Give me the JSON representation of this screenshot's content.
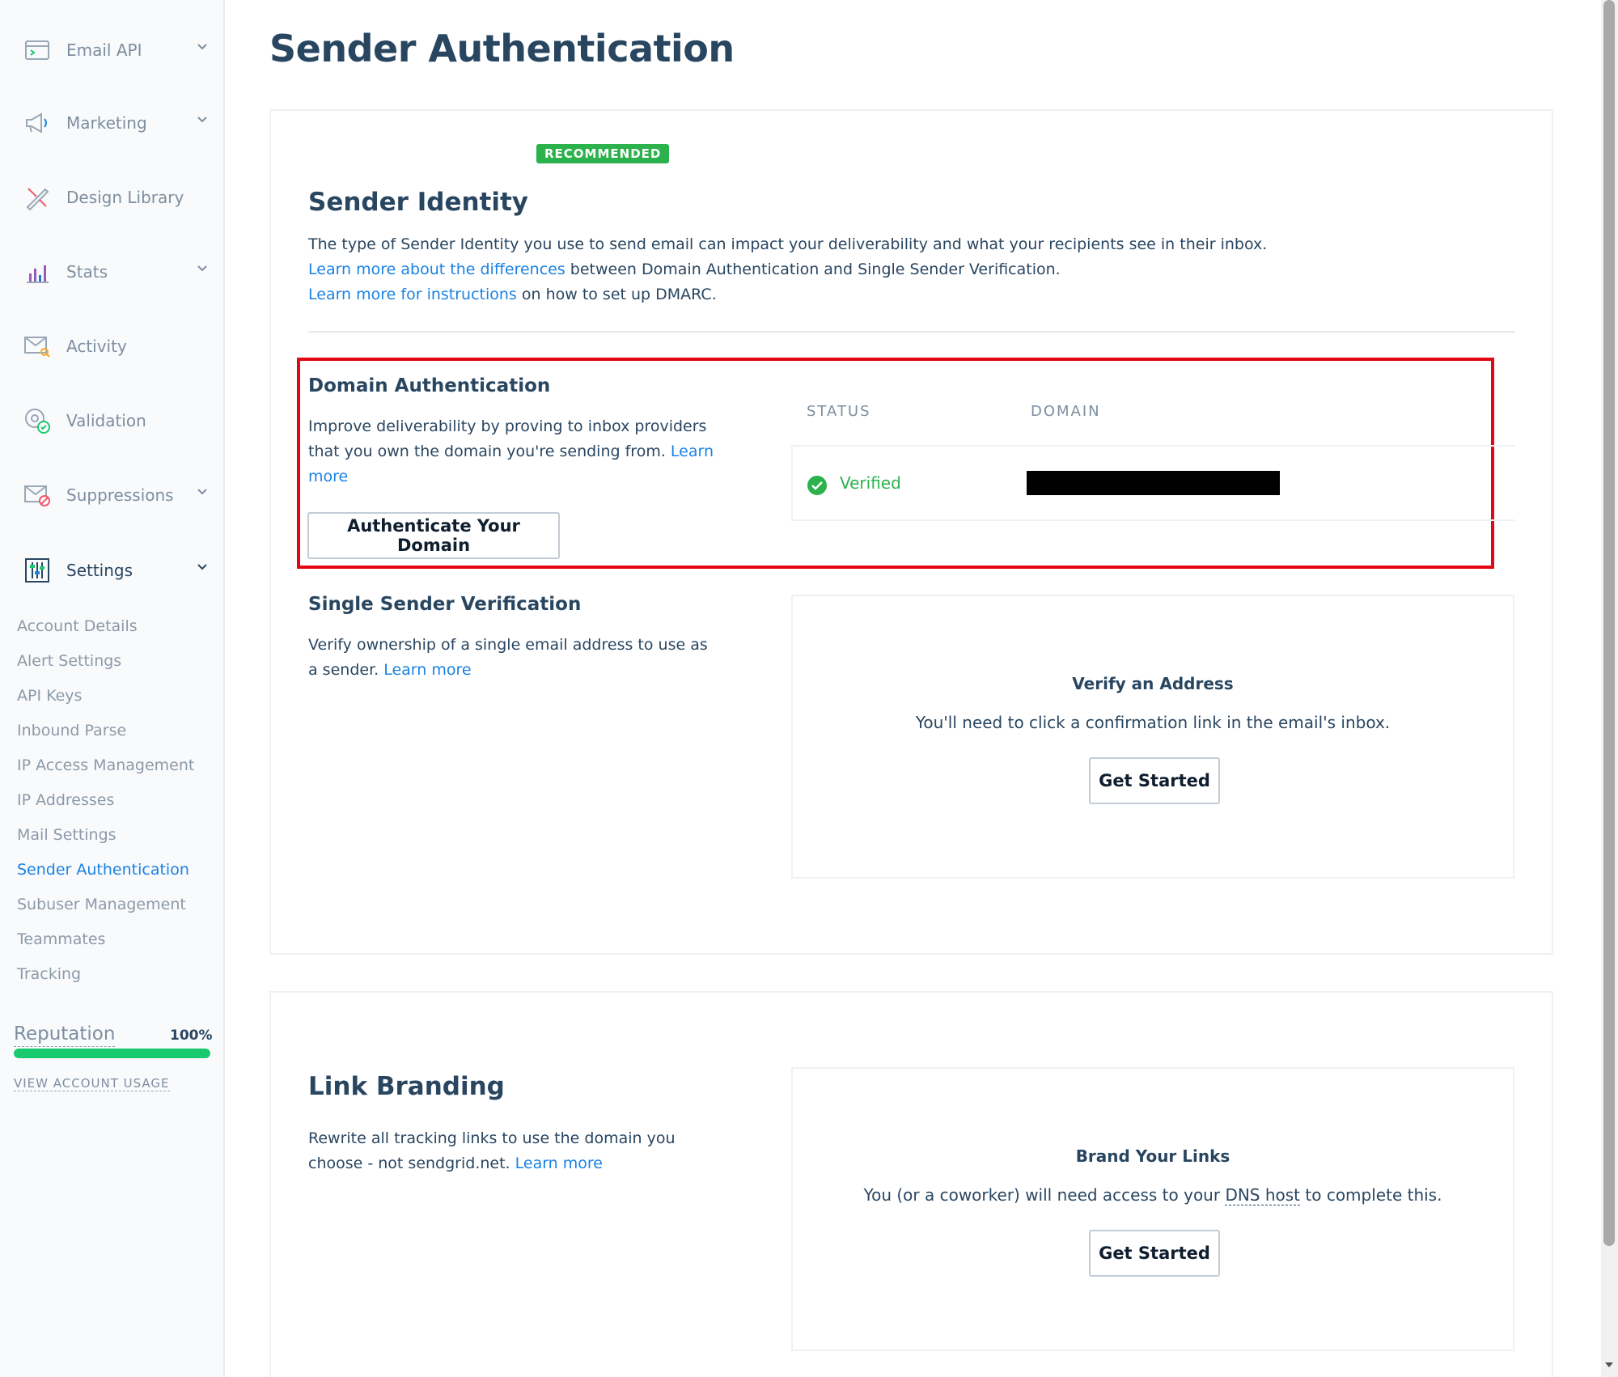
{
  "sidebar": {
    "nav": [
      {
        "label": "Email API",
        "icon": "email-api-icon"
      },
      {
        "label": "Marketing",
        "icon": "megaphone-icon"
      },
      {
        "label": "Design Library",
        "icon": "design-tools-icon"
      },
      {
        "label": "Stats",
        "icon": "bar-chart-icon"
      },
      {
        "label": "Activity",
        "icon": "activity-envelope-icon"
      },
      {
        "label": "Validation",
        "icon": "at-check-icon"
      },
      {
        "label": "Suppressions",
        "icon": "envelope-block-icon"
      },
      {
        "label": "Settings",
        "icon": "settings-panel-icon"
      }
    ],
    "settings_items": [
      "Account Details",
      "Alert Settings",
      "API Keys",
      "Inbound Parse",
      "IP Access Management",
      "IP Addresses",
      "Mail Settings",
      "Sender Authentication",
      "Subuser Management",
      "Teammates",
      "Tracking"
    ],
    "active_item": "Sender Authentication",
    "reputation": {
      "label": "Reputation",
      "value": "100%",
      "fraction": 1.0
    },
    "usage_link": "VIEW ACCOUNT USAGE"
  },
  "main": {
    "title": "Sender Authentication",
    "sender_identity": {
      "badge": "RECOMMENDED",
      "heading": "Sender Identity",
      "line1": "The type of Sender Identity you use to send email can impact your deliverability and what your recipients see in their inbox.",
      "link1": "Learn more about the differences",
      "line2_rest": " between Domain Authentication and Single Sender Verification.",
      "link2": "Learn more for instructions",
      "line3_rest": " on how to set up DMARC."
    },
    "domain_auth": {
      "heading": "Domain Authentication",
      "desc": "Improve deliverability by proving to inbox providers that you own the domain you're sending from. ",
      "learn_more": "Learn more",
      "button": "Authenticate Your Domain",
      "status_header": "STATUS",
      "domain_header": "DOMAIN",
      "status": "Verified"
    },
    "single_sender": {
      "heading": "Single Sender Verification",
      "desc": "Verify ownership of a single email address to use as a sender. ",
      "learn_more": "Learn more",
      "panel_title": "Verify an Address",
      "panel_text": "You'll need to click a confirmation link in the email's inbox.",
      "button": "Get Started"
    },
    "link_branding": {
      "heading": "Link Branding",
      "desc": "Rewrite all tracking links to use the domain you choose - not sendgrid.net. ",
      "learn_more": "Learn more",
      "panel_title": "Brand Your Links",
      "panel_text_pre": "You (or a coworker) will need access to your ",
      "panel_text_dns": "DNS host",
      "panel_text_post": " to complete this.",
      "button": "Get Started"
    }
  },
  "colors": {
    "accent": "#1a82e2",
    "success": "#2bb24c",
    "highlight": "#e30613",
    "text": "#294661"
  }
}
